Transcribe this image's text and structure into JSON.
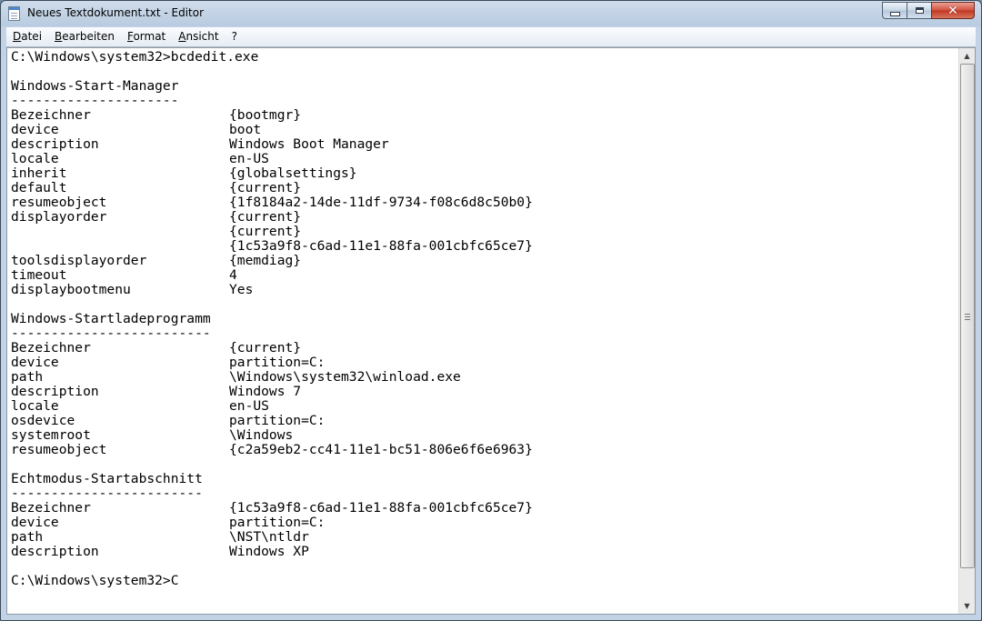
{
  "window": {
    "title": "Neues Textdokument.txt - Editor"
  },
  "menu": [
    "Datei",
    "Bearbeiten",
    "Format",
    "Ansicht",
    "?"
  ],
  "editor": {
    "lines": [
      [
        "C:\\Windows\\system32>bcdedit.exe",
        ""
      ],
      [
        "",
        ""
      ],
      [
        "Windows-Start-Manager",
        ""
      ],
      [
        "---------------------",
        ""
      ],
      [
        "Bezeichner",
        "{bootmgr}"
      ],
      [
        "device",
        "boot"
      ],
      [
        "description",
        "Windows Boot Manager"
      ],
      [
        "locale",
        "en-US"
      ],
      [
        "inherit",
        "{globalsettings}"
      ],
      [
        "default",
        "{current}"
      ],
      [
        "resumeobject",
        "{1f8184a2-14de-11df-9734-f08c6d8c50b0}"
      ],
      [
        "displayorder",
        "{current}"
      ],
      [
        "",
        "{current}"
      ],
      [
        "",
        "{1c53a9f8-c6ad-11e1-88fa-001cbfc65ce7}"
      ],
      [
        "toolsdisplayorder",
        "{memdiag}"
      ],
      [
        "timeout",
        "4"
      ],
      [
        "displaybootmenu",
        "Yes"
      ],
      [
        "",
        ""
      ],
      [
        "Windows-Startladeprogramm",
        ""
      ],
      [
        "-------------------------",
        ""
      ],
      [
        "Bezeichner",
        "{current}"
      ],
      [
        "device",
        "partition=C:"
      ],
      [
        "path",
        "\\Windows\\system32\\winload.exe"
      ],
      [
        "description",
        "Windows 7"
      ],
      [
        "locale",
        "en-US"
      ],
      [
        "osdevice",
        "partition=C:"
      ],
      [
        "systemroot",
        "\\Windows"
      ],
      [
        "resumeobject",
        "{c2a59eb2-cc41-11e1-bc51-806e6f6e6963}"
      ],
      [
        "",
        ""
      ],
      [
        "Echtmodus-Startabschnitt",
        ""
      ],
      [
        "------------------------",
        ""
      ],
      [
        "Bezeichner",
        "{1c53a9f8-c6ad-11e1-88fa-001cbfc65ce7}"
      ],
      [
        "device",
        "partition=C:"
      ],
      [
        "path",
        "\\NST\\ntldr"
      ],
      [
        "description",
        "Windows XP"
      ],
      [
        "",
        ""
      ],
      [
        "C:\\Windows\\system32>C",
        ""
      ]
    ]
  }
}
